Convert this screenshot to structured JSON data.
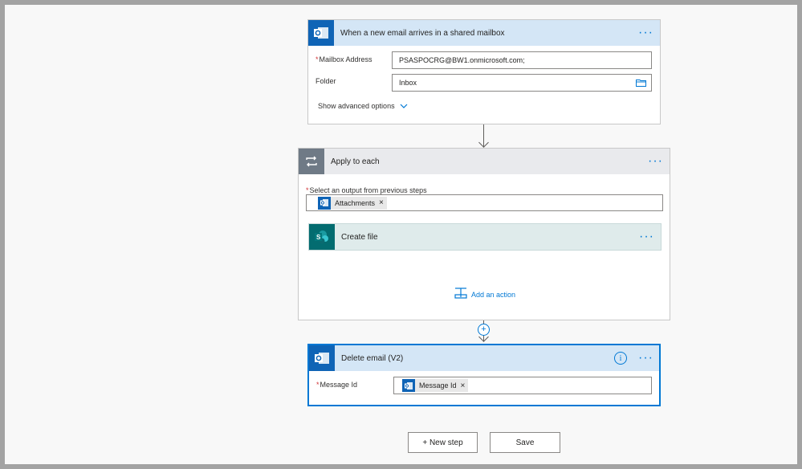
{
  "trigger": {
    "title": "When a new email arrives in a shared mailbox",
    "icon": "outlook-icon",
    "fields": {
      "mailbox_label": "Mailbox Address",
      "mailbox_value": "PSASPOCRG@BW1.onmicrosoft.com;",
      "folder_label": "Folder",
      "folder_value": "Inbox"
    },
    "advanced_label": "Show advanced options"
  },
  "apply_each": {
    "title": "Apply to each",
    "icon": "loop-icon",
    "select_label": "Select an output from previous steps",
    "token_label": "Attachments",
    "create_file": {
      "title": "Create file",
      "icon": "sharepoint-icon"
    },
    "add_action_label": "Add an action"
  },
  "delete_email": {
    "title": "Delete email (V2)",
    "icon": "outlook-icon",
    "message_id_label": "Message Id",
    "token_label": "Message Id"
  },
  "footer": {
    "new_step_label": "+ New step",
    "save_label": "Save"
  },
  "colors": {
    "accent": "#0078d4",
    "outlook": "#0f64b6",
    "sharepoint": "#036c70",
    "trigger_header": "#d4e6f6",
    "loop_header": "#e9eaed",
    "sharepoint_header": "#dfebeb",
    "required": "#d13438"
  }
}
